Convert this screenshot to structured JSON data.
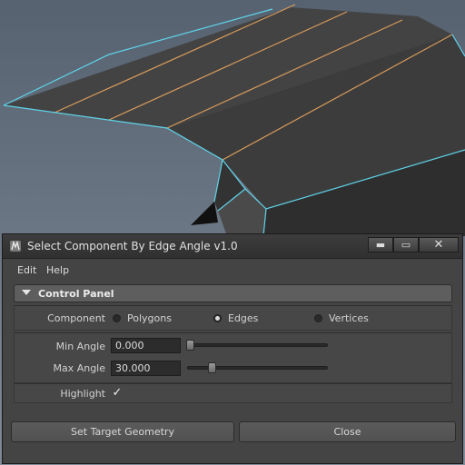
{
  "window": {
    "title": "Select Component By Edge Angle v1.0",
    "controls": {
      "minimize": "▬",
      "maximize": "▭",
      "close": "✕"
    }
  },
  "menu": [
    "Edit",
    "Help"
  ],
  "panel": {
    "title": "Control Panel",
    "component_label": "Component",
    "component_options": [
      "Polygons",
      "Edges",
      "Vertices"
    ],
    "component_selected": "Edges",
    "min_angle_label": "Min Angle",
    "min_angle_value": "0.000",
    "max_angle_label": "Max Angle",
    "max_angle_value": "30.000",
    "highlight_label": "Highlight",
    "highlight_checked": true,
    "highlight_glyph": "✓"
  },
  "buttons": {
    "set_target": "Set Target Geometry",
    "close": "Close"
  },
  "icons": {
    "app": "maya-logo-icon",
    "collapse": "triangle-down-icon"
  },
  "colors": {
    "viewport_bg": "#6f7c8a",
    "mesh_face": "#3f3f3f",
    "selected_edge": "#5fd0e6",
    "highlight_edge": "#d8a060",
    "dialog_bg": "#444444"
  }
}
